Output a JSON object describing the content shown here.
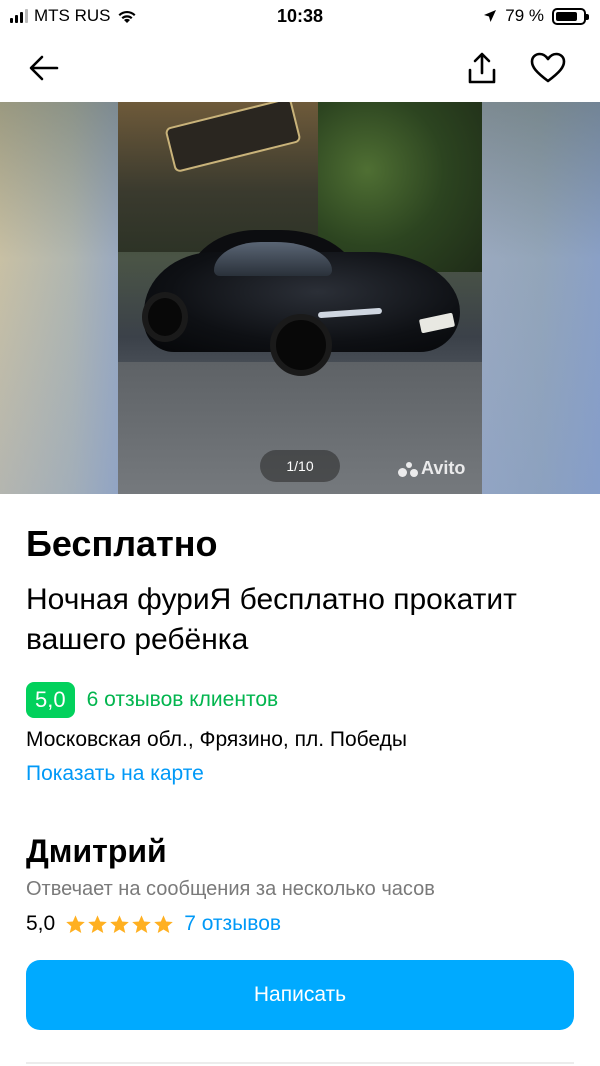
{
  "status_bar": {
    "carrier": "MTS RUS",
    "time": "10:38",
    "battery": "79 %",
    "battery_level": 0.79
  },
  "nav": {
    "back_icon": "arrow-left-icon",
    "share_icon": "share-icon",
    "favorite_icon": "heart-icon"
  },
  "gallery": {
    "counter": "1/10",
    "watermark": "Avito"
  },
  "listing": {
    "price": "Бесплатно",
    "title": "Ночная фуриЯ бесплатно прокатит вашего ребёнка",
    "rating": "5,0",
    "reviews": "6 отзывов клиентов",
    "address": "Московская обл., Фрязино, пл. Победы",
    "map_link": "Показать на карте"
  },
  "seller": {
    "name": "Дмитрий",
    "response": "Отвечает на сообщения за несколько часов",
    "rating": "5,0",
    "stars": 5,
    "reviews": "7 отзывов"
  },
  "actions": {
    "write": "Написать"
  },
  "colors": {
    "green_badge": "#02d15c",
    "link_blue": "#0099f7",
    "button_blue": "#00aaff",
    "star": "#ffb021"
  }
}
